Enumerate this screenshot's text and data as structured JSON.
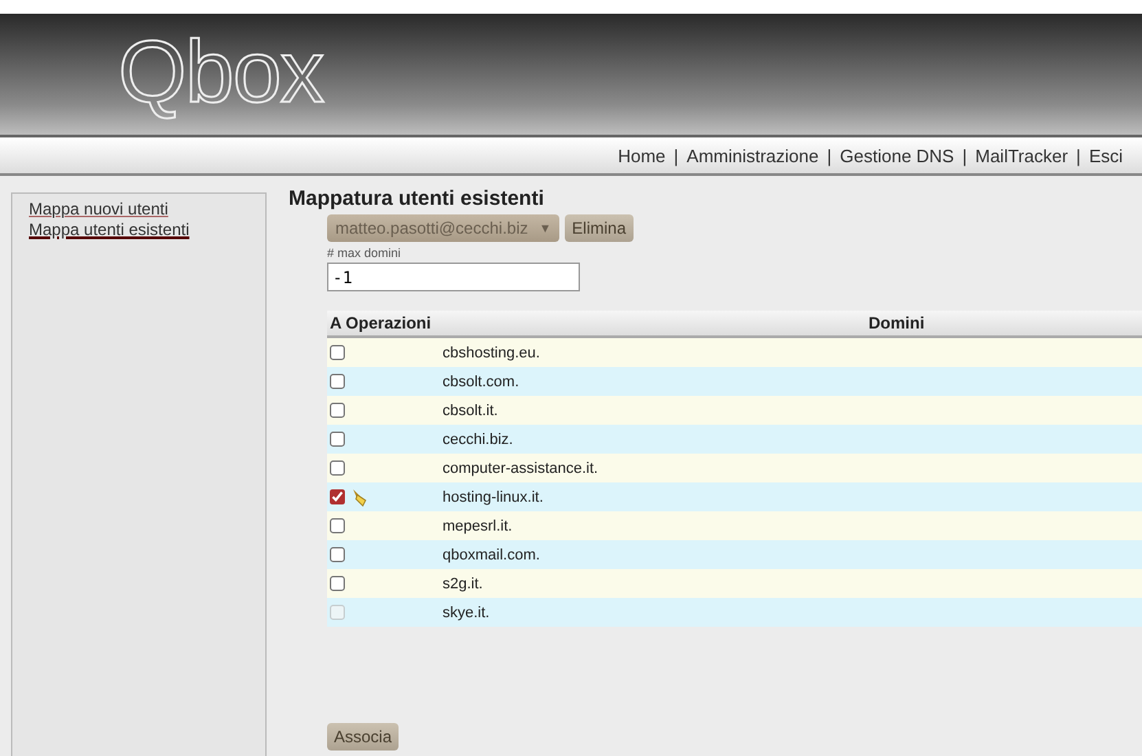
{
  "logo": "Qbox",
  "nav_separator": "|",
  "nav": [
    {
      "label": "Home"
    },
    {
      "label": "Amministrazione"
    },
    {
      "label": "Gestione DNS"
    },
    {
      "label": "MailTracker"
    },
    {
      "label": "Esci"
    }
  ],
  "sidebar": {
    "items": [
      {
        "label": "Mappa nuovi utenti",
        "selected": false
      },
      {
        "label": "Mappa utenti esistenti",
        "selected": true
      }
    ]
  },
  "title": "Mappatura utenti esistenti",
  "user_select": {
    "value": "matteo.pasotti@cecchi.biz",
    "caret": "▼"
  },
  "delete_button": "Elimina",
  "max_domains": {
    "label": "# max domini",
    "value": "-1"
  },
  "table": {
    "columns": [
      "A Operazioni",
      "Domini"
    ],
    "rows": [
      {
        "domain": "cbshosting.eu.",
        "checked": false,
        "disabled": false,
        "edit_icon": false
      },
      {
        "domain": "cbsolt.com.",
        "checked": false,
        "disabled": false,
        "edit_icon": false
      },
      {
        "domain": "cbsolt.it.",
        "checked": false,
        "disabled": false,
        "edit_icon": false
      },
      {
        "domain": "cecchi.biz.",
        "checked": false,
        "disabled": false,
        "edit_icon": false
      },
      {
        "domain": "computer-assistance.it.",
        "checked": false,
        "disabled": false,
        "edit_icon": false
      },
      {
        "domain": "hosting-linux.it.",
        "checked": true,
        "disabled": false,
        "edit_icon": true
      },
      {
        "domain": "mepesrl.it.",
        "checked": false,
        "disabled": false,
        "edit_icon": false
      },
      {
        "domain": "qboxmail.com.",
        "checked": false,
        "disabled": false,
        "edit_icon": false
      },
      {
        "domain": "s2g.it.",
        "checked": false,
        "disabled": false,
        "edit_icon": false
      },
      {
        "domain": "skye.it.",
        "checked": false,
        "disabled": true,
        "edit_icon": false
      }
    ]
  },
  "associate_button": "Associa"
}
